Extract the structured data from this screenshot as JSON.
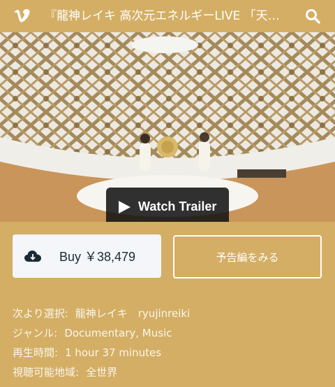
{
  "header": {
    "title": "『龍神レイキ 高次元エネルギーLIVE 「天地...",
    "logo_icon": "vimeo-logo-icon",
    "search_icon": "search-icon"
  },
  "player": {
    "watch_trailer_label": "Watch Trailer",
    "play_icon": "play-icon"
  },
  "actions": {
    "buy_label": "Buy ￥38,479",
    "buy_icon": "cloud-icon",
    "preview_label": "予告編をみる"
  },
  "details": [
    {
      "key": "次より選択:",
      "value": "龍神レイキ　ryujinreiki"
    },
    {
      "key": "ジャンル:",
      "value": "Documentary, Music"
    },
    {
      "key": "再生時間:",
      "value": "1 hour 37 minutes"
    },
    {
      "key": "視聴可能地域:",
      "value": "全世界"
    }
  ],
  "colors": {
    "background": "#d3ae64",
    "buy_button_bg": "#f4f6f9",
    "trailer_button_bg": "#141414"
  }
}
